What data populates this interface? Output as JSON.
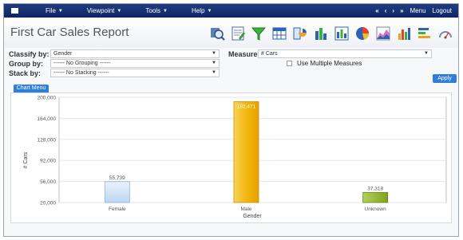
{
  "menubar": {
    "items": [
      {
        "label": "File"
      },
      {
        "label": "Viewpoint"
      },
      {
        "label": "Tools"
      },
      {
        "label": "Help"
      }
    ],
    "nav_first": "«",
    "nav_prev": "‹",
    "nav_next": "›",
    "nav_last": "»",
    "menu_link": "Menu",
    "logout_link": "Logout"
  },
  "report": {
    "title": "First Car Sales Report"
  },
  "toolbar_icons": [
    "magnify-icon",
    "edit-report-icon",
    "filter-icon",
    "table-icon",
    "pivot-icon",
    "column-chart-icon",
    "stacked-chart-icon",
    "pie-chart-icon",
    "area-chart-icon",
    "bar-chart-icon",
    "horizontal-bar-icon",
    "gauge-icon"
  ],
  "controls": {
    "classify_label": "Classify by:",
    "classify_value": "Gender",
    "group_label": "Group by:",
    "group_value": "------ No Grouping ------",
    "stack_label": "Stack by:",
    "stack_value": "------ No Stacking ------",
    "measure_label": "Measure:",
    "measure_value": "# Cars",
    "multiple_measures_label": "Use Multiple Measures",
    "multiple_measures_checked": false,
    "apply_label": "Apply",
    "chart_menu_label": "Chart Menu"
  },
  "chart_data": {
    "type": "bar",
    "categories": [
      "Female",
      "Male",
      "Unknown"
    ],
    "values": [
      55739,
      192471,
      37318
    ],
    "value_labels": [
      "55,739",
      "192,471",
      "37,318"
    ],
    "xlabel": "Gender",
    "ylabel": "# Cars",
    "ylim": [
      20000,
      200000
    ],
    "yticks": [
      "200,000",
      "164,000",
      "128,000",
      "92,000",
      "56,000",
      "20,000"
    ],
    "ytick_values": [
      200000,
      164000,
      128000,
      92000,
      56000,
      20000
    ],
    "colors": [
      "#cfe2f7",
      "#f2b70f",
      "#8fb526"
    ],
    "grid": true
  }
}
